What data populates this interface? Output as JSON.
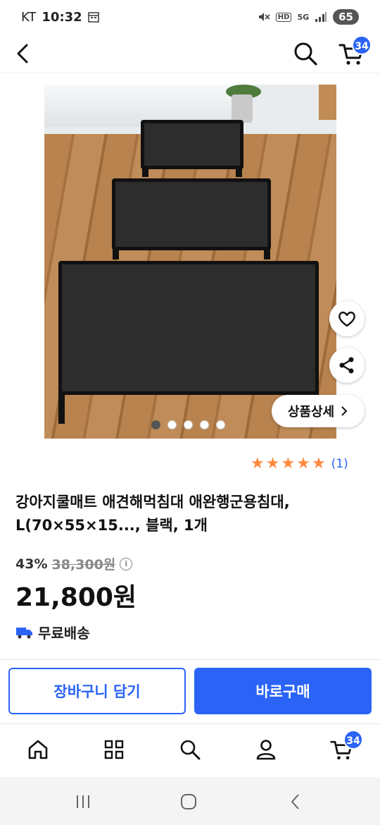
{
  "status_bar": {
    "carrier": "KT",
    "time": "10:32",
    "network": "5G",
    "hd": "HD",
    "battery": "65"
  },
  "header": {
    "cart_count": "34"
  },
  "product": {
    "image_dots": {
      "count": 5,
      "active_index": 0
    },
    "detail_button_label": "상품상세",
    "rating": {
      "stars": 5,
      "count_label": "(1)"
    },
    "title": "강아지쿨매트 애견해먹침대 애완행군용침대, L(70×55×15..., 블랙, 1개",
    "discount": "43%",
    "original_price": "38,300원",
    "sale_price": "21,800원",
    "shipping": "무료배송"
  },
  "actions": {
    "add_to_cart": "장바구니 담기",
    "buy_now": "바로구매"
  },
  "tab_bar": {
    "cart_count": "34",
    "items": [
      "home-icon",
      "categories-icon",
      "search-icon",
      "user-icon",
      "cart-icon"
    ]
  },
  "colors": {
    "primary": "#2a63f5",
    "star": "#ff8a3d"
  }
}
